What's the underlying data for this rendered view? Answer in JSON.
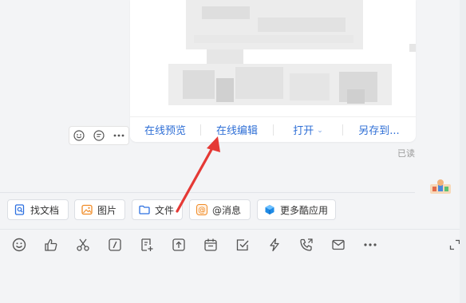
{
  "file_card": {
    "actions": [
      {
        "label": "在线预览"
      },
      {
        "label": "在线编辑"
      },
      {
        "label": "打开"
      },
      {
        "label": "另存到..."
      }
    ]
  },
  "message": {
    "read_status": "已读"
  },
  "quick_tools": [
    {
      "label": "找文档",
      "icon": "doc-search-icon",
      "color": "#2b6fe0"
    },
    {
      "label": "图片",
      "icon": "image-icon",
      "color": "#f08a24"
    },
    {
      "label": "文件",
      "icon": "folder-icon",
      "color": "#2b6fe0"
    },
    {
      "label": "@消息",
      "icon": "at-icon",
      "color": "#f08a24"
    },
    {
      "label": "更多酷应用",
      "icon": "cube-icon",
      "color": "#1e8be6"
    }
  ],
  "colors": {
    "accent": "#2f6fd6",
    "annotation_arrow": "#e53935"
  }
}
